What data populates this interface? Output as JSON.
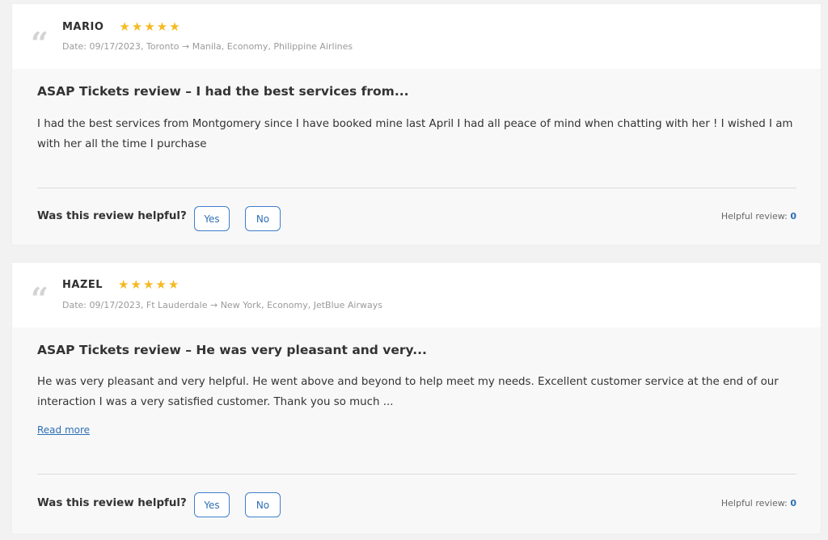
{
  "reviews": [
    {
      "name": "MARIO",
      "rating": 5,
      "meta": "Date: 09/17/2023, Toronto → Manila, Economy, Philippine Airlines",
      "title": "ASAP Tickets review – I had the best services from...",
      "body": "I had the best services from Montgomery since I have booked mine last April I had all peace of mind when chatting with her ! I wished I am with her all the time I purchase",
      "read_more": "",
      "helpful_question": "Was this review helpful?",
      "yes_label": "Yes",
      "no_label": "No",
      "helpful_label": "Helpful review:",
      "helpful_count": "0"
    },
    {
      "name": "HAZEL",
      "rating": 5,
      "meta": "Date: 09/17/2023, Ft Lauderdale → New York, Economy, JetBlue Airways",
      "title": "ASAP Tickets review – He was very pleasant and very...",
      "body": "He was very pleasant and very helpful. He went above and beyond to help meet my needs. Excellent customer service at the end of our interaction I was a very satisfied customer. Thank you so much ...",
      "read_more": "Read more",
      "helpful_question": "Was this review helpful?",
      "yes_label": "Yes",
      "no_label": "No",
      "helpful_label": "Helpful review:",
      "helpful_count": "0"
    }
  ],
  "icons": {
    "quote": "quote-icon",
    "star": "star-icon"
  },
  "colors": {
    "star": "#f5b921",
    "accent": "#2f6fb6"
  }
}
